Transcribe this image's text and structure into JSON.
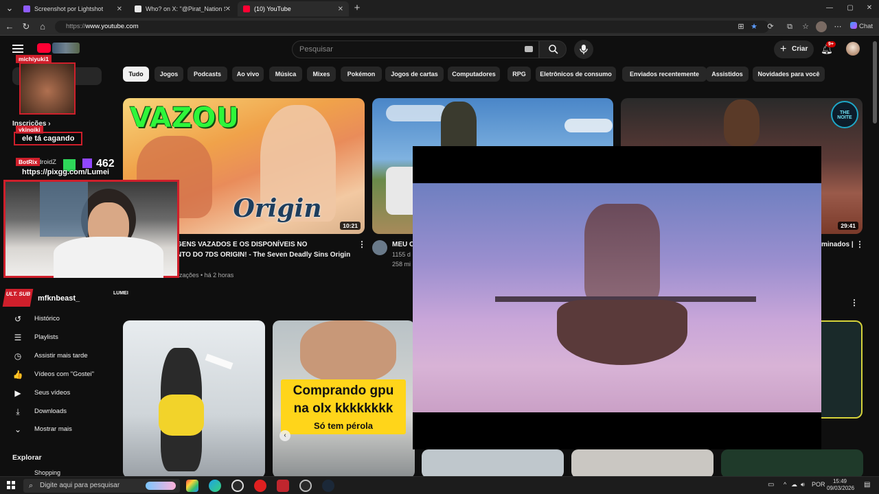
{
  "browser": {
    "tabs": [
      {
        "label": "Screenshot por Lightshot",
        "fav_color": "#8e5cff"
      },
      {
        "label": "Who? on X: \"@Pirat_Nation Same",
        "fav_color": "#e8e8e8"
      },
      {
        "label": "(10) YouTube",
        "fav_color": "#ff0033"
      }
    ],
    "url_prefix": "https://",
    "url_host": "www.youtube.com",
    "chat_label": "Chat"
  },
  "youtube": {
    "search_placeholder": "Pesquisar",
    "create_label": "Criar",
    "notif_count": "9+",
    "chips": [
      "Tudo",
      "Jogos",
      "Podcasts",
      "Ao vivo",
      "Música",
      "Mixes",
      "Pokémon",
      "Jogos de cartas",
      "Computadores",
      "RPG",
      "Eletrônicos de consumo",
      "Enviados recentemente",
      "Assistidos",
      "Novidades para você"
    ],
    "sidebar": {
      "subscriptions_label": "Inscrições",
      "items": [
        {
          "label": "Histórico",
          "icon": "history-icon",
          "glyph": "↺"
        },
        {
          "label": "Playlists",
          "icon": "playlists-icon",
          "glyph": "☰"
        },
        {
          "label": "Assistir mais tarde",
          "icon": "watch-later-icon",
          "glyph": "◷"
        },
        {
          "label": "Vídeos com \"Gostei\"",
          "icon": "like-icon",
          "glyph": "👍"
        },
        {
          "label": "Seus vídeos",
          "icon": "your-videos-icon",
          "glyph": "▶"
        },
        {
          "label": "Downloads",
          "icon": "download-icon",
          "glyph": "⤓"
        },
        {
          "label": "Mostrar mais",
          "icon": "chevron-down-icon",
          "glyph": "⌄"
        }
      ],
      "explore_label": "Explorar",
      "shopping_label": "Shopping"
    },
    "videos_row1": [
      {
        "thumb_text": "VAZOU",
        "thumb_sub": "Origin",
        "duration": "10:21",
        "title_line1": "GENS VAZADOS E OS DISPONÍVEIS NO",
        "title_line2": "NTO DO 7DS ORIGIN! - The Seven Deadly Sins Origin",
        "meta": "lizações • há 2 horas"
      },
      {
        "title_line1": "MEU C",
        "meta1": "1155 d",
        "meta2": "258 mi"
      },
      {
        "duration": "29:41",
        "title_line1": "minados |",
        "badge": "THE NOITE"
      }
    ],
    "videos_row2": [
      {
        "caption1": "Comprando gpu",
        "caption2": "na olx kkkkkkkk",
        "caption3": "Só tem pérola"
      }
    ]
  },
  "stream_overlay": {
    "chat": [
      {
        "user": "michiyuki1",
        "message": ""
      },
      {
        "user": "ykingiki",
        "message": "ele tá cagando"
      },
      {
        "user": "BotRix",
        "message": "https://pixgg.com/Lumei"
      }
    ],
    "partial_text": "droidZ",
    "viewer_count": "462",
    "ult_sub_label": "ULT. SUB",
    "ult_sub_name": "mfknbeast_",
    "streamer_brand": "LUMEI"
  },
  "taskbar": {
    "search_placeholder": "Digite aqui para pesquisar",
    "lang": "POR",
    "time": "15:49",
    "date": "09/03/2026"
  }
}
